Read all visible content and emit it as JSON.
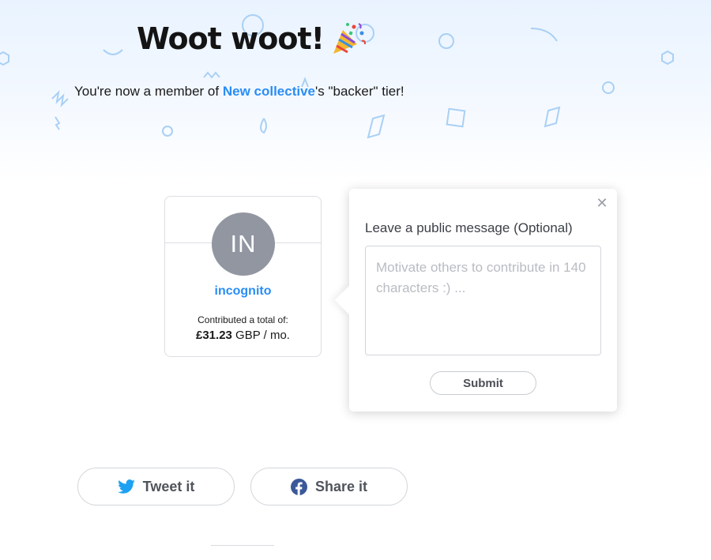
{
  "header": {
    "title": "Woot woot!",
    "title_icon": "party-popper-icon",
    "subtitle_prefix": "You're now a member of ",
    "collective_name": "New collective",
    "subtitle_suffix": "'s \"backer\" tier!"
  },
  "member_card": {
    "avatar_initials": "IN",
    "name": "incognito",
    "contributed_label": "Contributed a total of:",
    "amount": "£31.23",
    "amount_suffix": " GBP / mo."
  },
  "message_popup": {
    "label": "Leave a public message (Optional)",
    "placeholder": "Motivate others to contribute in 140 characters :) ...",
    "value": "",
    "submit_label": "Submit",
    "close_icon": "close-icon"
  },
  "share": {
    "tweet_label": "Tweet it",
    "tweet_icon": "twitter-icon",
    "facebook_label": "Share it",
    "facebook_icon": "facebook-icon"
  },
  "colors": {
    "accent": "#2a8df5",
    "avatar_bg": "#9196a1",
    "twitter": "#1da1f2",
    "facebook": "#3b5998",
    "confetti": "#a9d0f5"
  }
}
